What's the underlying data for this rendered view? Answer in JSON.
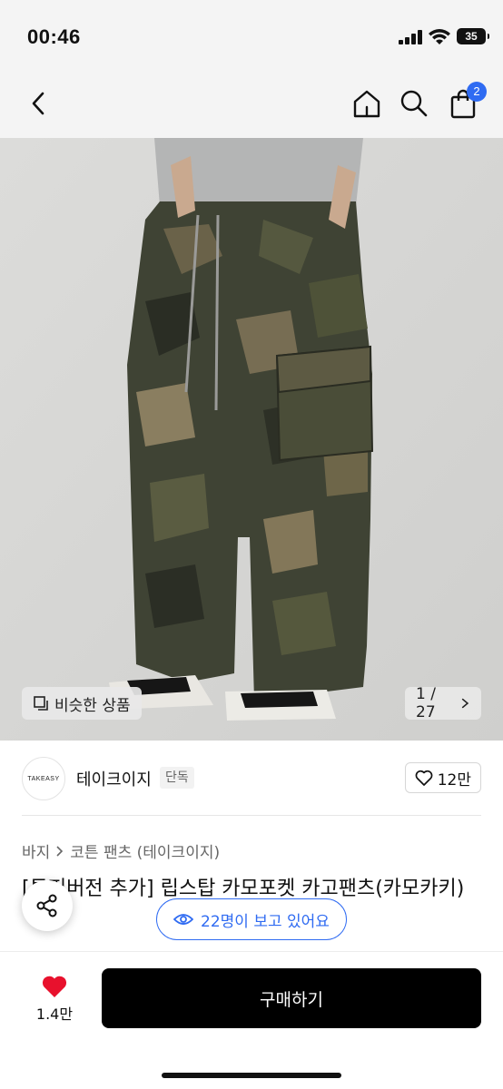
{
  "status_bar": {
    "time": "00:46",
    "battery": "35"
  },
  "nav": {
    "back_icon": "chevron-left-icon",
    "home_icon": "home-icon",
    "search_icon": "search-icon",
    "cart_icon": "shopping-bag-icon",
    "cart_badge": "2"
  },
  "image": {
    "similar_label": "비슷한 상품",
    "counter": "1 / 27"
  },
  "brand": {
    "logo_text": "TAKEASY",
    "name": "테이크이지",
    "tag": "단독",
    "like_count": "12만"
  },
  "breadcrumb": {
    "category": "바지",
    "subcategory": "코튼 팬츠 (테이크이지)"
  },
  "product": {
    "title": "[투퍼버전 추가] 립스탑 카모포켓 카고팬츠(카모카키)"
  },
  "viewers": {
    "text": "22명이 보고 있어요"
  },
  "bottom": {
    "wish_count": "1.4만",
    "buy_label": "구매하기"
  },
  "colors": {
    "accent": "#2f6bf2",
    "heart": "#e8112d",
    "buy_button": "#000000"
  }
}
